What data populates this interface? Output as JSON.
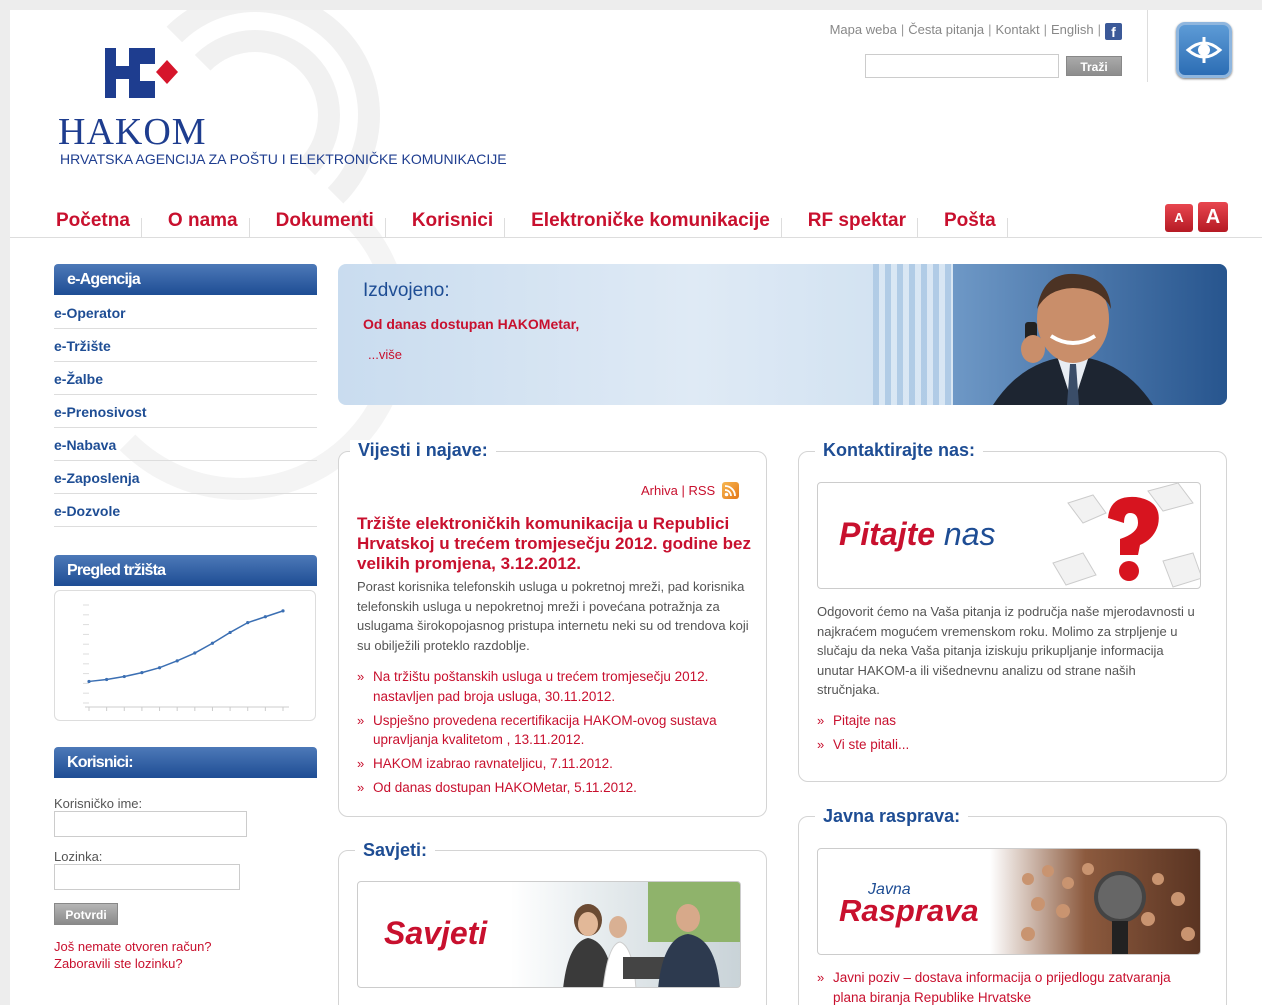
{
  "header": {
    "logo_text": "HAKOM",
    "logo_subtitle": "HRVATSKA AGENCIJA ZA POŠTU I ELEKTRONIČKE KOMUNIKACIJE",
    "top_links": [
      "Mapa weba",
      "Česta pitanja",
      "Kontakt",
      "English"
    ],
    "search_button": "Traži",
    "font_small": "A",
    "font_large": "A"
  },
  "nav": [
    "Početna",
    "O nama",
    "Dokumenti",
    "Korisnici",
    "Elektroničke komunikacije",
    "RF spektar",
    "Pošta"
  ],
  "left": {
    "eagency_title": "e-Agencija",
    "eagency_items": [
      "e-Operator",
      "e-Tržište",
      "e-Žalbe",
      "e-Prenosivost",
      "e-Nabava",
      "e-Zaposlenja",
      "e-Dozvole"
    ],
    "market_title": "Pregled tržišta",
    "users_title": "Korisnici:",
    "username_label": "Korisničko ime:",
    "password_label": "Lozinka:",
    "submit_label": "Potvrdi",
    "no_account_link": "Još nemate otvoren račun?",
    "forgot_link": "Zaboravili ste lozinku?"
  },
  "featured": {
    "title": "Izdvojeno:",
    "text": "Od danas dostupan HAKOMetar,",
    "more": "...više"
  },
  "news": {
    "title": "Vijesti i najave:",
    "archive": "Arhiva",
    "rss": "RSS",
    "main_title": "Tržište elektroničkih komunikacija u Republici Hrvatskoj u trećem tromjesečju 2012. godine bez velikih promjena, 3.12.2012.",
    "main_body": "Porast korisnika telefonskih usluga u pokretnoj mreži, pad korisnika telefonskih usluga u nepokretnoj mreži i povećana potražnja za uslugama širokopojasnog pristupa internetu neki su od trendova koji su obilježili proteklo razdoblje.",
    "items": [
      "Na tržištu poštanskih usluga u trećem tromjesečju 2012. nastavljen pad broja usluga, 30.11.2012.",
      "Uspješno provedena recertifikacija HAKOM-ovog sustava upravljanja kvalitetom , 13.11.2012.",
      "HAKOM izabrao ravnateljicu, 7.11.2012.",
      "Od danas dostupan HAKOMetar, 5.11.2012."
    ]
  },
  "tips": {
    "title": "Savjeti:",
    "card": "Savjeti"
  },
  "contact": {
    "title": "Kontaktirajte nas:",
    "card_word1": "Pitajte",
    "card_word2": "nas",
    "body": "Odgovorit ćemo na Vaša pitanja iz područja naše mjerodavnosti u najkraćem mogućem vremenskom roku. Molimo za strpljenje u slučaju da neka Vaša pitanja iziskuju prikupljanje informacija unutar HAKOM-a ili višednevnu analizu od strane naših stručnjaka.",
    "links": [
      "Pitajte nas",
      "Vi ste pitali..."
    ]
  },
  "debate": {
    "title": "Javna rasprava:",
    "card_small": "Javna",
    "card_big": "Rasprava",
    "items": [
      "Javni poziv – dostava informacija o prijedlogu zatvaranja plana biranja Republike Hrvatske"
    ]
  },
  "chart_data": {
    "type": "line",
    "values": [
      22,
      24,
      27,
      31,
      36,
      43,
      51,
      61,
      72,
      82,
      88,
      94
    ]
  },
  "colors": {
    "brand_red": "#c8102e",
    "brand_blue": "#1e4d94"
  }
}
